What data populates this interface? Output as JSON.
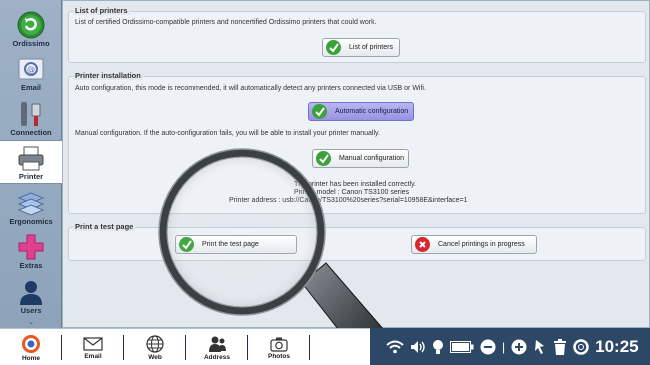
{
  "sidebar": {
    "items": [
      {
        "label": "Ordissimo",
        "icon": "ordissimo-back-icon"
      },
      {
        "label": "Email",
        "icon": "email-icon"
      },
      {
        "label": "Connection",
        "icon": "connection-icon"
      },
      {
        "label": "Printer",
        "icon": "printer-icon"
      },
      {
        "label": "Ergonomics",
        "icon": "ergonomics-icon"
      },
      {
        "label": "Extras",
        "icon": "extras-icon"
      },
      {
        "label": "Users",
        "icon": "users-icon"
      }
    ],
    "active": "Printer",
    "scroll_down": "⌄"
  },
  "sections": {
    "list_of_printers": {
      "title": "List of printers",
      "description": "List of certified Ordissimo-compatible printers and noncertified Ordissimo printers that could work.",
      "button": "List of printers"
    },
    "printer_installation": {
      "title": "Printer installation",
      "auto_description": "Auto configuration, this mode is recommended, it will automatically detect any printers connected via USB or Wifi.",
      "auto_button": "Automatic configuration",
      "manual_description": "Manual configuration. If the auto-configuration fails, you will be able to install your printer manually.",
      "manual_button": "Manual configuration",
      "status_line1": "The printer has been installed correctly.",
      "status_line2": "Printer model : Canon TS3100 series",
      "status_line3": "Printer address : usb://Canon/TS3100%20series?serial=10958E&interface=1"
    },
    "test_page": {
      "title": "Print a test page",
      "print_button": "Print the test page",
      "cancel_button": "Cancel printings in progress"
    }
  },
  "taskbar": {
    "apps": [
      {
        "label": "Home",
        "icon": "home-icon"
      },
      {
        "label": "Email",
        "icon": "envelope-icon"
      },
      {
        "label": "Web",
        "icon": "globe-icon"
      },
      {
        "label": "Address",
        "icon": "address-book-icon"
      },
      {
        "label": "Photos",
        "icon": "camera-icon"
      }
    ],
    "clock": "10:25"
  },
  "colors": {
    "accent_blue": "#9793e4",
    "check_green": "#3aa23a",
    "cancel_red": "#d8262e",
    "tray_bg": "#2d4866"
  }
}
